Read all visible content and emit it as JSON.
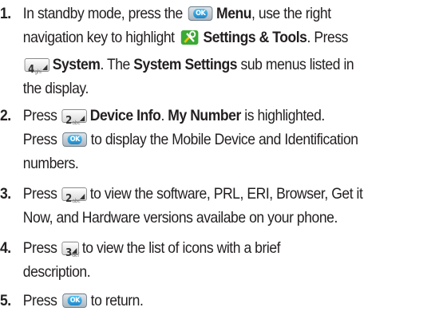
{
  "steps": [
    {
      "number": "1.",
      "lines": [
        [
          "In standby mode, press the",
          "Menu",
          ", use the right"
        ],
        [
          "navigation key to highlight",
          "Settings & Tools",
          ". Press"
        ],
        [
          "System",
          ". The",
          "System Settings",
          "sub menus listed in"
        ],
        [
          "the display."
        ]
      ]
    },
    {
      "number": "2.",
      "lines": [
        [
          "Press",
          "Device Info",
          ".",
          "My Number",
          "is highlighted."
        ],
        [
          "Press",
          "to display the Mobile Device and Identification"
        ],
        [
          "numbers."
        ]
      ]
    },
    {
      "number": "3.",
      "lines": [
        [
          "Press",
          "to view the software, PRL, ERI, Browser, Get it"
        ],
        [
          "Now, and Hardware versions availabe on your phone."
        ]
      ]
    },
    {
      "number": "4.",
      "lines": [
        [
          "Press",
          "to view the list of icons with a brief"
        ],
        [
          "description."
        ]
      ]
    },
    {
      "number": "5.",
      "lines": [
        [
          "Press",
          "to return."
        ]
      ]
    }
  ],
  "keys": {
    "ok": "OK",
    "two": {
      "digit": "2",
      "letters": "abc"
    },
    "three": {
      "digit": "3",
      "letters": "def"
    },
    "four": {
      "digit": "4",
      "letters": "ghi"
    }
  },
  "icons": {
    "ok_key": "ok-key-icon",
    "settings_tools": "settings-tools-icon",
    "key_2": "key-2-icon",
    "key_3": "key-3-icon",
    "key_4": "key-4-icon"
  },
  "colors": {
    "text": "#231f20",
    "ok_key_blue": "#1f86c9",
    "tools_green": "#3aa935",
    "tools_yellow": "#f2c200"
  }
}
